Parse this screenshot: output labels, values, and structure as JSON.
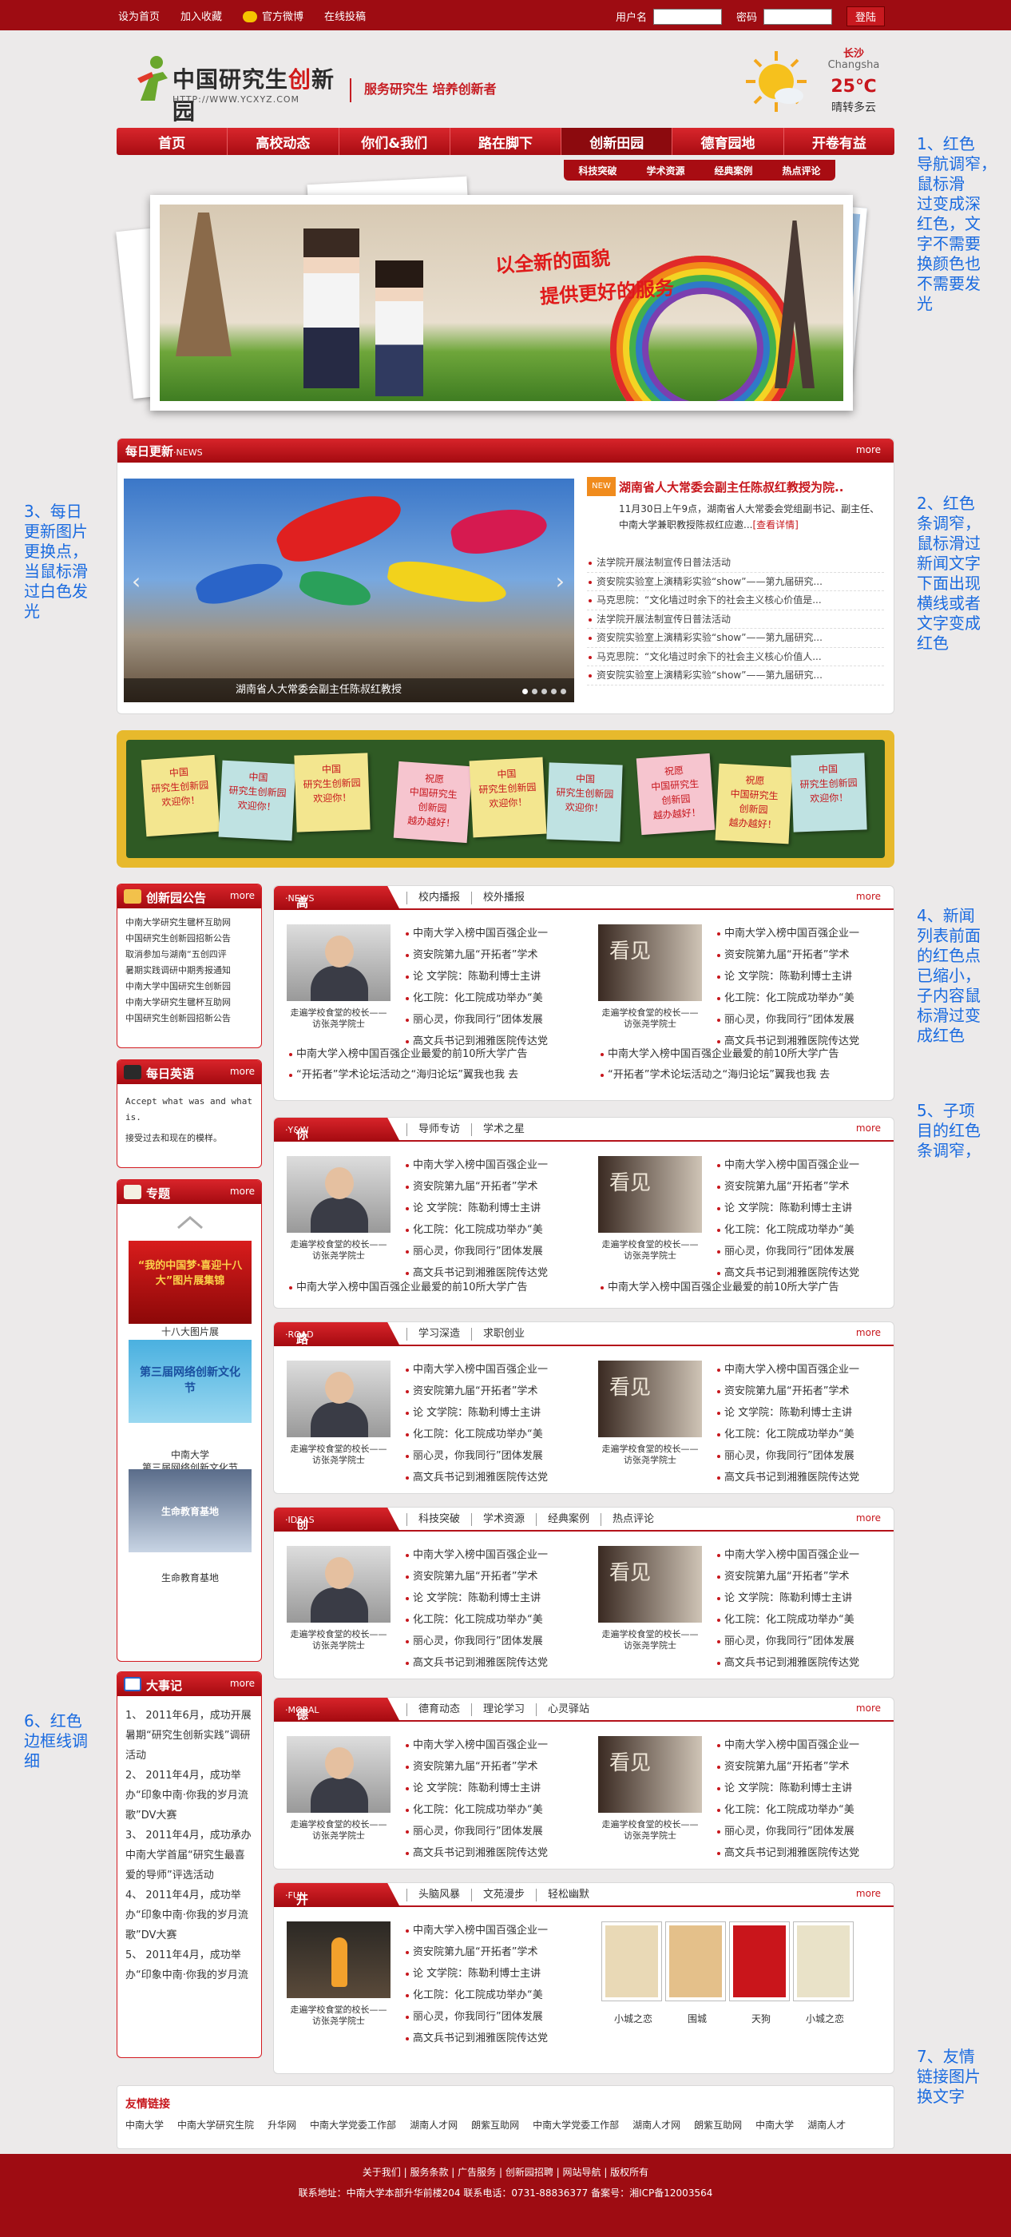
{
  "topbar": {
    "links": [
      "设为首页",
      "加入收藏",
      "官方微博",
      "在线投稿"
    ],
    "username_label": "用户名",
    "password_label": "密码",
    "login_button": "登陆"
  },
  "logo": {
    "brand_a": "中国研究生",
    "brand_b": "创",
    "brand_c": "新园",
    "url": "HTTP://WWW.YCXYZ.COM"
  },
  "slogan": "服务研究生  培养创新者",
  "weather": {
    "city": "长沙",
    "city_en": "Changsha",
    "temp": "25℃",
    "desc": "晴转多云"
  },
  "nav": {
    "items": [
      "首页",
      "高校动态",
      "你们&我们",
      "路在脚下",
      "创新田园",
      "德育园地",
      "开卷有益"
    ],
    "active_index": 4
  },
  "subnav": [
    "科技突破",
    "学术资源",
    "经典案例",
    "热点评论"
  ],
  "banner": {
    "line1": "以全新的面貌",
    "line2": "提供更好的服务"
  },
  "daily": {
    "title": "每日更新",
    "title_en": "·NEWS",
    "more": "more",
    "slide_caption": "湖南省人大常委会副主任陈叔红教授",
    "hot_tag": "NEW",
    "hot_title": "湖南省人大常委会副主任陈叔红教授为院..",
    "hot_desc": "11月30日上午9点，湖南省人大常委会党组副书记、副主任、中南大学兼职教授陈叔红应邀...",
    "hot_link": "[查看详情]",
    "items": [
      "法学院开展法制宣传日普法活动",
      "资安院实验室上演精彩实验“show”——第九届研究...",
      "马克思院：“文化墙过时余下的社会主义核心价值是...",
      "法学院开展法制宣传日普法活动",
      "资安院实验室上演精彩实验“show”——第九届研究...",
      "马克思院：“文化墙过时余下的社会主义核心价值人...",
      "资安院实验室上演精彩实验“show”——第九届研究..."
    ]
  },
  "board": {
    "notes": [
      {
        "text": "中国\n研究生创新园\n欢迎你！",
        "color": "#f3e68f"
      },
      {
        "text": "中国\n研究生创新园\n欢迎你！",
        "color": "#bfe2e2"
      },
      {
        "text": "中国\n研究生创新园\n欢迎你！",
        "color": "#f3e68f"
      },
      {
        "text": "祝愿\n中国研究生\n创新园\n越办越好！",
        "color": "#f6c5cf"
      },
      {
        "text": "中国\n研究生创新园\n欢迎你！",
        "color": "#f3e68f"
      },
      {
        "text": "中国\n研究生创新园\n欢迎你！",
        "color": "#bfe2e2"
      },
      {
        "text": "祝愿\n中国研究生\n创新园\n越办越好！",
        "color": "#f6c5cf"
      },
      {
        "text": "祝愿\n中国研究生\n创新园\n越办越好！",
        "color": "#f3e68f"
      },
      {
        "text": "中国\n研究生创新园\n欢迎你！",
        "color": "#bfe2e2"
      }
    ]
  },
  "left": {
    "announce": {
      "title": "创新园公告",
      "more": "more",
      "items": [
        "中南大学研究生毽杯互助网",
        "中国研究生创新园招新公告",
        "取消参加与湖南“五创四评",
        "暑期实践调研中期秀报通知",
        "中南大学中国研究生创新园",
        "中南大学研究生毽杯互助网",
        "中国研究生创新园招新公告"
      ]
    },
    "english": {
      "title": "每日英语",
      "more": "more",
      "en": "Accept what was and what is.",
      "zh": "接受过去和现在的模样。"
    },
    "topic": {
      "title": "专题",
      "more": "more",
      "items": [
        {
          "label": "十八大图片展",
          "img_text": "“我的中国梦·喜迎十八大”图片展集锦"
        },
        {
          "label": "中南大学\n第三届网络创新文化节",
          "img_text": "第三届网络创新文化节"
        },
        {
          "label": "生命教育基地",
          "img_text": "生命教育基地"
        }
      ]
    },
    "events": {
      "title": "大事记",
      "more": "more",
      "items": [
        "1、   2011年6月，成功开展暑期“研究生创新实践”调研活动",
        "2、   2011年4月，成功举办“印象中南·你我的岁月流歌”DV大赛",
        "3、   2011年4月，成功承办中南大学首届“研究生最喜爱的导师”评选活动",
        "4、   2011年4月，成功举办“印象中南·你我的岁月流歌”DV大赛",
        "5、   2011年4月，成功举办“印象中南·你我的岁月流"
      ]
    }
  },
  "sections": [
    {
      "title": "高校动态",
      "en": "·NEWS",
      "tabs": [
        "校内播报",
        "校外播报"
      ],
      "more": "more",
      "extra": true
    },
    {
      "title": "你们&我们",
      "en": "·Y&W",
      "tabs": [
        "导师专访",
        "学术之星"
      ],
      "more": "more",
      "extra2": true
    },
    {
      "title": "路在脚下",
      "en": "·ROAD",
      "tabs": [
        "学习深造",
        "求职创业"
      ],
      "more": "more"
    },
    {
      "title": "创新田园",
      "en": "·IDEAS",
      "tabs": [
        "科技突破",
        "学术资源",
        "经典案例",
        "热点评论"
      ],
      "more": "more"
    },
    {
      "title": "德育园地",
      "en": "·MORAL",
      "tabs": [
        "德育动态",
        "理论学习",
        "心灵驿站"
      ],
      "more": "more"
    },
    {
      "title": "开卷有益",
      "en": "·FUN",
      "tabs": [
        "头脑风暴",
        "文苑漫步",
        "轻松幽默"
      ],
      "more": "more"
    }
  ],
  "col_a": {
    "caption": "走遍学校食堂的校长——访张尧学院士",
    "items": [
      "中南大学入榜中国百强企业一",
      "资安院第九届“开拓者”学术",
      "论 文学院：陈勒利博士主讲",
      "化工院：化工院成功举办“美",
      "丽心灵，你我同行”团体发展",
      "高文兵书记到湘雅医院传达党"
    ]
  },
  "col_b": {
    "caption": "走遍学校食堂的校长——访张尧学院士",
    "img_word": "看见",
    "items": [
      "中南大学入榜中国百强企业一",
      "资安院第九届“开拓者”学术",
      "论 文学院：陈勒利博士主讲",
      "化工院：化工院成功举办“美",
      "丽心灵，你我同行”团体发展",
      "高文兵书记到湘雅医院传达党"
    ]
  },
  "extra_lines": {
    "a1": "中南大学入榜中国百强企业最爱的前10所大学广告",
    "b1": "中南大学入榜中国百强企业最爱的前10所大学广告",
    "a2": "“开拓者”学术论坛活动之“海归论坛”翼我也我 去",
    "b2": "“开拓者”学术论坛活动之“海归论坛”翼我也我 去",
    "c1": "中南大学入榜中国百强企业最爱的前10所大学广告",
    "c2": "中南大学入榜中国百强企业最爱的前10所大学广告"
  },
  "fun": {
    "caption": "走遍学校食堂的校长——访张尧学院士",
    "books": [
      {
        "title": "小城之恋",
        "color": "#e9d9b6"
      },
      {
        "title": "围城",
        "color": "#e4c08a"
      },
      {
        "title": "天狗",
        "color": "#c9151b"
      },
      {
        "title": "小城之恋",
        "color": "#e9e2c8"
      }
    ]
  },
  "notes_right": [
    "1、红色\n导航调窄，\n鼠标滑\n过变成深\n红色，文\n字不需要\n换颜色也\n不需要发\n光",
    "2、红色\n条调窄，\n鼠标滑过\n新闻文字\n下面出现\n横线或者\n文字变成\n红色",
    "4、新闻\n列表前面\n的红色点\n已缩小，\n子内容鼠\n标滑过变\n成红色",
    "5、子项\n目的红色\n条调窄，",
    "7、友情\n链接图片\n换文字"
  ],
  "notes_left": [
    "3、每日\n更新图片\n更换点，\n当鼠标滑\n过白色发\n光",
    "6、红色\n边框线调\n细"
  ],
  "friends": {
    "title": "友情链接",
    "links": [
      "中南大学",
      "中南大学研究生院",
      "升华网",
      "中南大学党委工作部",
      "湖南人才网",
      "朗紫互助网",
      "中南大学党委工作部",
      "湖南人才网",
      "朗紫互助网",
      "中南大学",
      "湖南人才"
    ]
  },
  "footer": {
    "line1": "关于我们 | 服务条款 | 广告服务 | 创新园招聘 | 网站导航 | 版权所有",
    "line2": "联系地址：中南大学本部升华前楼204 联系电话：0731-88836377 备案号：湘ICP备12003564"
  }
}
